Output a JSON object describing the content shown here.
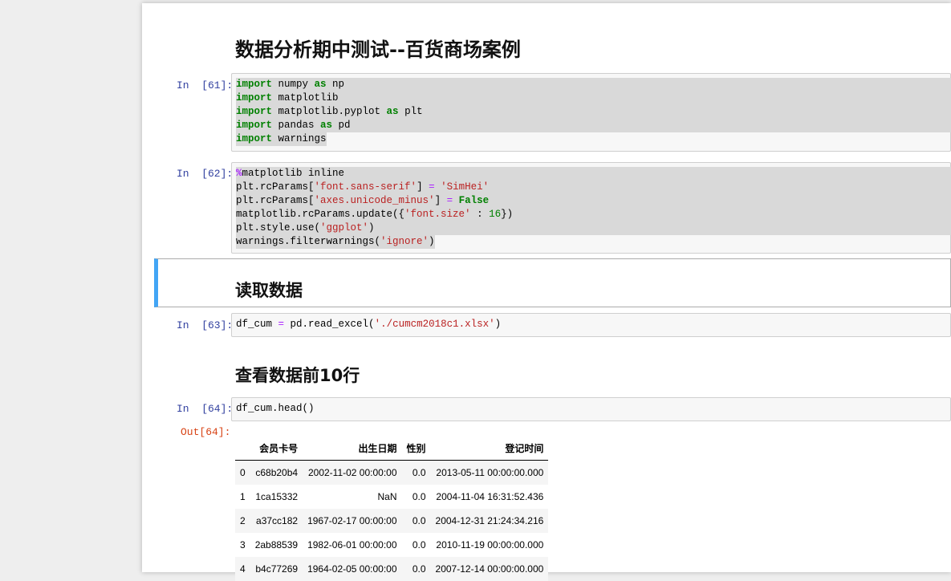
{
  "title": "数据分析期中测试--百货商场案例",
  "cells": [
    {
      "prompt": "In  [61]:",
      "lines": [
        [
          [
            "kw",
            "import"
          ],
          [
            "t",
            " numpy "
          ],
          [
            "kw",
            "as"
          ],
          [
            "t",
            " np"
          ]
        ],
        [
          [
            "kw",
            "import"
          ],
          [
            "t",
            " matplotlib"
          ]
        ],
        [
          [
            "kw",
            "import"
          ],
          [
            "t",
            " matplotlib.pyplot "
          ],
          [
            "kw",
            "as"
          ],
          [
            "t",
            " plt"
          ]
        ],
        [
          [
            "kw",
            "import"
          ],
          [
            "t",
            " pandas "
          ],
          [
            "kw",
            "as"
          ],
          [
            "t",
            " pd"
          ]
        ],
        [
          [
            "kw",
            "import"
          ],
          [
            "t",
            " warnings"
          ]
        ]
      ]
    },
    {
      "prompt": "In  [62]:",
      "lines": [
        [
          [
            "mag",
            "%"
          ],
          [
            "t",
            "matplotlib inline"
          ]
        ],
        [
          [
            "t",
            "plt.rcParams["
          ],
          [
            "str",
            "'font.sans-serif'"
          ],
          [
            "t",
            "] "
          ],
          [
            "op",
            "="
          ],
          [
            "t",
            " "
          ],
          [
            "str",
            "'SimHei'"
          ]
        ],
        [
          [
            "t",
            "plt.rcParams["
          ],
          [
            "str",
            "'axes.unicode_minus'"
          ],
          [
            "t",
            "] "
          ],
          [
            "op",
            "="
          ],
          [
            "t",
            " "
          ],
          [
            "kw",
            "False"
          ]
        ],
        [
          [
            "t",
            "matplotlib.rcParams.update({"
          ],
          [
            "str",
            "'font.size'"
          ],
          [
            "t",
            " : "
          ],
          [
            "num",
            "16"
          ],
          [
            "t",
            "})"
          ]
        ],
        [
          [
            "t",
            "plt.style.use("
          ],
          [
            "str",
            "'ggplot'"
          ],
          [
            "t",
            ")"
          ]
        ],
        [
          [
            "t",
            "warnings.filterwarnings("
          ],
          [
            "str",
            "'ignore'"
          ],
          [
            "t",
            ")"
          ]
        ]
      ]
    },
    {
      "prompt": "In  [63]:",
      "lines": [
        [
          [
            "t",
            "df_cum "
          ],
          [
            "op",
            "="
          ],
          [
            "t",
            " pd.read_excel("
          ],
          [
            "str",
            "'./cumcm2018c1.xlsx'"
          ],
          [
            "t",
            ")"
          ]
        ]
      ]
    },
    {
      "prompt": "In  [64]:",
      "lines": [
        [
          [
            "t",
            "df_cum.head()"
          ]
        ]
      ]
    }
  ],
  "heading_read": "读取数据",
  "heading_view": "查看数据前10行",
  "out_prompt": "Out[64]:",
  "table": {
    "columns": [
      "",
      "会员卡号",
      "出生日期",
      "性别",
      "登记时间"
    ],
    "rows": [
      [
        "0",
        "c68b20b4",
        "2002-11-02 00:00:00",
        "0.0",
        "2013-05-11 00:00:00.000"
      ],
      [
        "1",
        "1ca15332",
        "NaN",
        "0.0",
        "2004-11-04 16:31:52.436"
      ],
      [
        "2",
        "a37cc182",
        "1967-02-17 00:00:00",
        "0.0",
        "2004-12-31 21:24:34.216"
      ],
      [
        "3",
        "2ab88539",
        "1982-06-01 00:00:00",
        "0.0",
        "2010-11-19 00:00:00.000"
      ],
      [
        "4",
        "b4c77269",
        "1964-02-05 00:00:00",
        "0.0",
        "2007-12-14 00:00:00.000"
      ]
    ]
  }
}
